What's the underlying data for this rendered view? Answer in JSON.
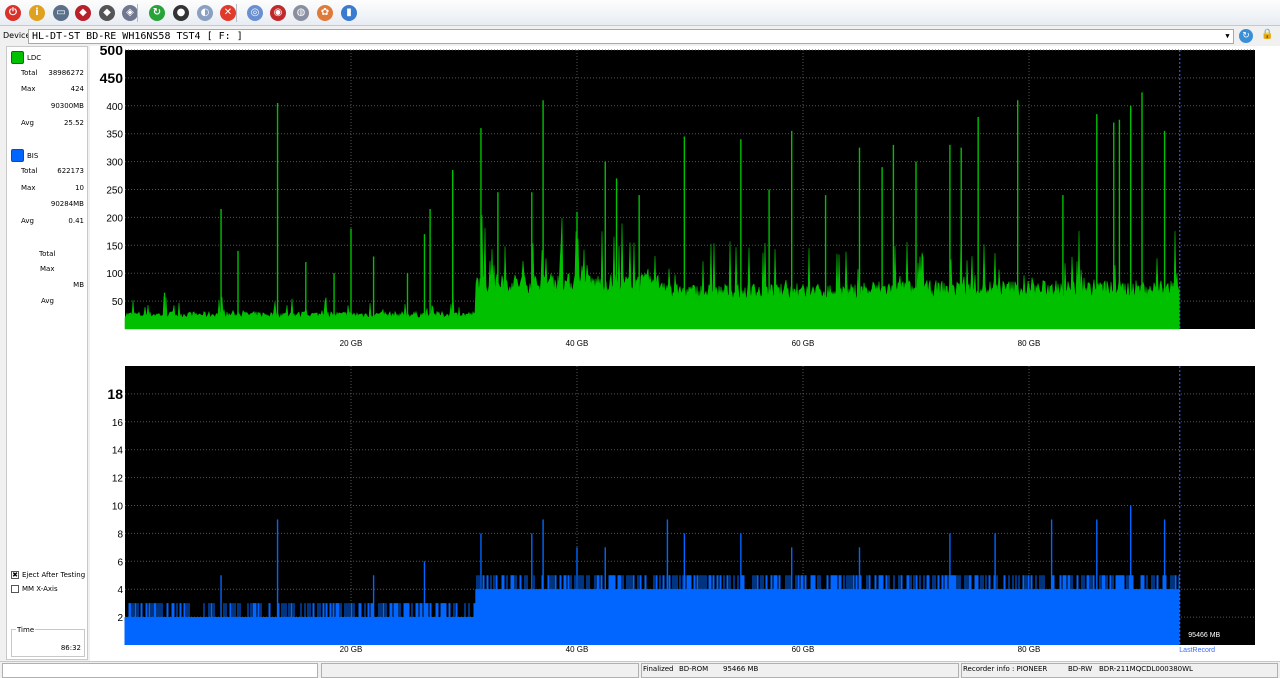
{
  "toolbar": {
    "icons": [
      {
        "name": "power-icon",
        "glyph": "⏻",
        "color": "#d8322a"
      },
      {
        "name": "info-icon",
        "glyph": "i",
        "color": "#e0a020"
      },
      {
        "name": "device-icon",
        "glyph": "▭",
        "color": "#5a6f8a"
      },
      {
        "name": "erase-icon",
        "glyph": "◆",
        "color": "#b8202a"
      },
      {
        "name": "disc-tool-icon",
        "glyph": "◆",
        "color": "#555"
      },
      {
        "name": "copy-icon",
        "glyph": "◈",
        "color": "#707890"
      },
      {
        "name": "start-test-icon",
        "glyph": "↻",
        "color": "#27a33a"
      },
      {
        "name": "scan-icon",
        "glyph": "●",
        "color": "#333"
      },
      {
        "name": "eject-icon",
        "glyph": "◐",
        "color": "#8aa0c0"
      },
      {
        "name": "stop-icon",
        "glyph": "✕",
        "color": "#e03a2a"
      },
      {
        "name": "disc-info-icon",
        "glyph": "◎",
        "color": "#6a8fd0"
      },
      {
        "name": "burn-icon",
        "glyph": "◉",
        "color": "#c02a2a"
      },
      {
        "name": "save-icon",
        "glyph": "◍",
        "color": "#8a8fa0"
      },
      {
        "name": "settings-icon",
        "glyph": "✿",
        "color": "#e07a3a"
      },
      {
        "name": "chart-icon",
        "glyph": "▮",
        "color": "#3a7ad0"
      }
    ]
  },
  "device": {
    "label": "Device:",
    "value": "HL-DT-ST BD-RE  WH16NS58  TST4 [ F: ]"
  },
  "ldc": {
    "name": "LDC",
    "color": "#00c000",
    "total_label": "Total",
    "total": "38986272",
    "max_label": "Max",
    "max": "424",
    "max_pos": "90300MB",
    "avg_label": "Avg",
    "avg": "25.52"
  },
  "bis": {
    "name": "BIS",
    "color": "#0066ff",
    "total_label": "Total",
    "total": "622173",
    "max_label": "Max",
    "max": "10",
    "max_pos": "90284MB",
    "avg_label": "Avg",
    "avg": "0.41"
  },
  "third": {
    "total_label": "Total",
    "max_label": "Max",
    "mb_label": "MB",
    "avg_label": "Avg"
  },
  "options": {
    "eject_label": "Eject After Testing",
    "eject_checked": true,
    "mm_label": "MM X-Axis",
    "mm_checked": false
  },
  "time": {
    "label": "Time",
    "value": "86:32"
  },
  "chart_data": [
    {
      "type": "area",
      "series_name": "LDC",
      "color": "#00c000",
      "x_ticks": [
        "20 GB",
        "40 GB",
        "60 GB",
        "80 GB"
      ],
      "x_tick_values": [
        20,
        40,
        60,
        80
      ],
      "xlim": [
        0,
        100
      ],
      "y_ticks": [
        "50",
        "100",
        "150",
        "200",
        "250",
        "300",
        "350",
        "400",
        "450",
        "500"
      ],
      "y_tick_values": [
        50,
        100,
        150,
        200,
        250,
        300,
        350,
        400,
        450,
        500
      ],
      "ylim": [
        0,
        500
      ],
      "data_end_gb": 93.3,
      "segments": [
        {
          "from": 0,
          "to": 31,
          "base": 25
        },
        {
          "from": 31,
          "to": 48,
          "base": 80
        },
        {
          "from": 48,
          "to": 66,
          "base": 65
        },
        {
          "from": 66,
          "to": 93.3,
          "base": 70
        }
      ],
      "spikes": [
        [
          3.5,
          65
        ],
        [
          8.5,
          215
        ],
        [
          10,
          140
        ],
        [
          13.5,
          405
        ],
        [
          16,
          120
        ],
        [
          18.5,
          100
        ],
        [
          20,
          180
        ],
        [
          22,
          130
        ],
        [
          25,
          100
        ],
        [
          26.5,
          170
        ],
        [
          27,
          215
        ],
        [
          29,
          285
        ],
        [
          31.5,
          360
        ],
        [
          33,
          245
        ],
        [
          36,
          245
        ],
        [
          37,
          410
        ],
        [
          40,
          210
        ],
        [
          42.5,
          300
        ],
        [
          43.5,
          270
        ],
        [
          45.5,
          240
        ],
        [
          49.5,
          345
        ],
        [
          54.5,
          340
        ],
        [
          57,
          250
        ],
        [
          59,
          355
        ],
        [
          62,
          240
        ],
        [
          65,
          325
        ],
        [
          67,
          290
        ],
        [
          68,
          330
        ],
        [
          70,
          300
        ],
        [
          73,
          330
        ],
        [
          74,
          325
        ],
        [
          75.5,
          380
        ],
        [
          79,
          410
        ],
        [
          83,
          240
        ],
        [
          86,
          385
        ],
        [
          87.5,
          370
        ],
        [
          88,
          375
        ],
        [
          89,
          400
        ],
        [
          90,
          424
        ],
        [
          92,
          355
        ]
      ],
      "grid": true
    },
    {
      "type": "bar",
      "series_name": "BIS",
      "color": "#0066ff",
      "x_ticks": [
        "20 GB",
        "40 GB",
        "60 GB",
        "80 GB"
      ],
      "x_tick_values": [
        20,
        40,
        60,
        80
      ],
      "xlim": [
        0,
        100
      ],
      "y_ticks": [
        "2",
        "4",
        "6",
        "8",
        "10",
        "12",
        "14",
        "16",
        "18"
      ],
      "y_tick_values": [
        2,
        4,
        6,
        8,
        10,
        12,
        14,
        16,
        18
      ],
      "ylim": [
        0,
        20
      ],
      "data_end_gb": 93.3,
      "segments": [
        {
          "from": 0,
          "to": 31,
          "base": 2,
          "noise": 3
        },
        {
          "from": 31,
          "to": 93.3,
          "base": 4,
          "noise": 5
        }
      ],
      "spikes": [
        [
          8.5,
          5
        ],
        [
          13.5,
          9
        ],
        [
          22,
          5
        ],
        [
          26.5,
          6
        ],
        [
          31.5,
          8
        ],
        [
          36,
          8
        ],
        [
          37,
          9
        ],
        [
          40,
          7
        ],
        [
          42.5,
          7
        ],
        [
          48,
          9
        ],
        [
          49.5,
          8
        ],
        [
          54.5,
          8
        ],
        [
          59,
          7
        ],
        [
          65,
          7
        ],
        [
          73,
          8
        ],
        [
          77,
          8
        ],
        [
          82,
          9
        ],
        [
          86,
          9
        ],
        [
          89,
          10
        ],
        [
          92,
          9
        ]
      ],
      "end_label": "95466 MB",
      "marker_label": "LastRecord",
      "grid": true
    }
  ],
  "status": {
    "finalized": "Finalized",
    "disc_type": "BD-ROM",
    "capacity": "95466 MB",
    "recorder_label": "Recorder info : PIONEER",
    "media_type": "BD-RW",
    "recorder_model": "BDR-211MQCDL000380WL"
  }
}
